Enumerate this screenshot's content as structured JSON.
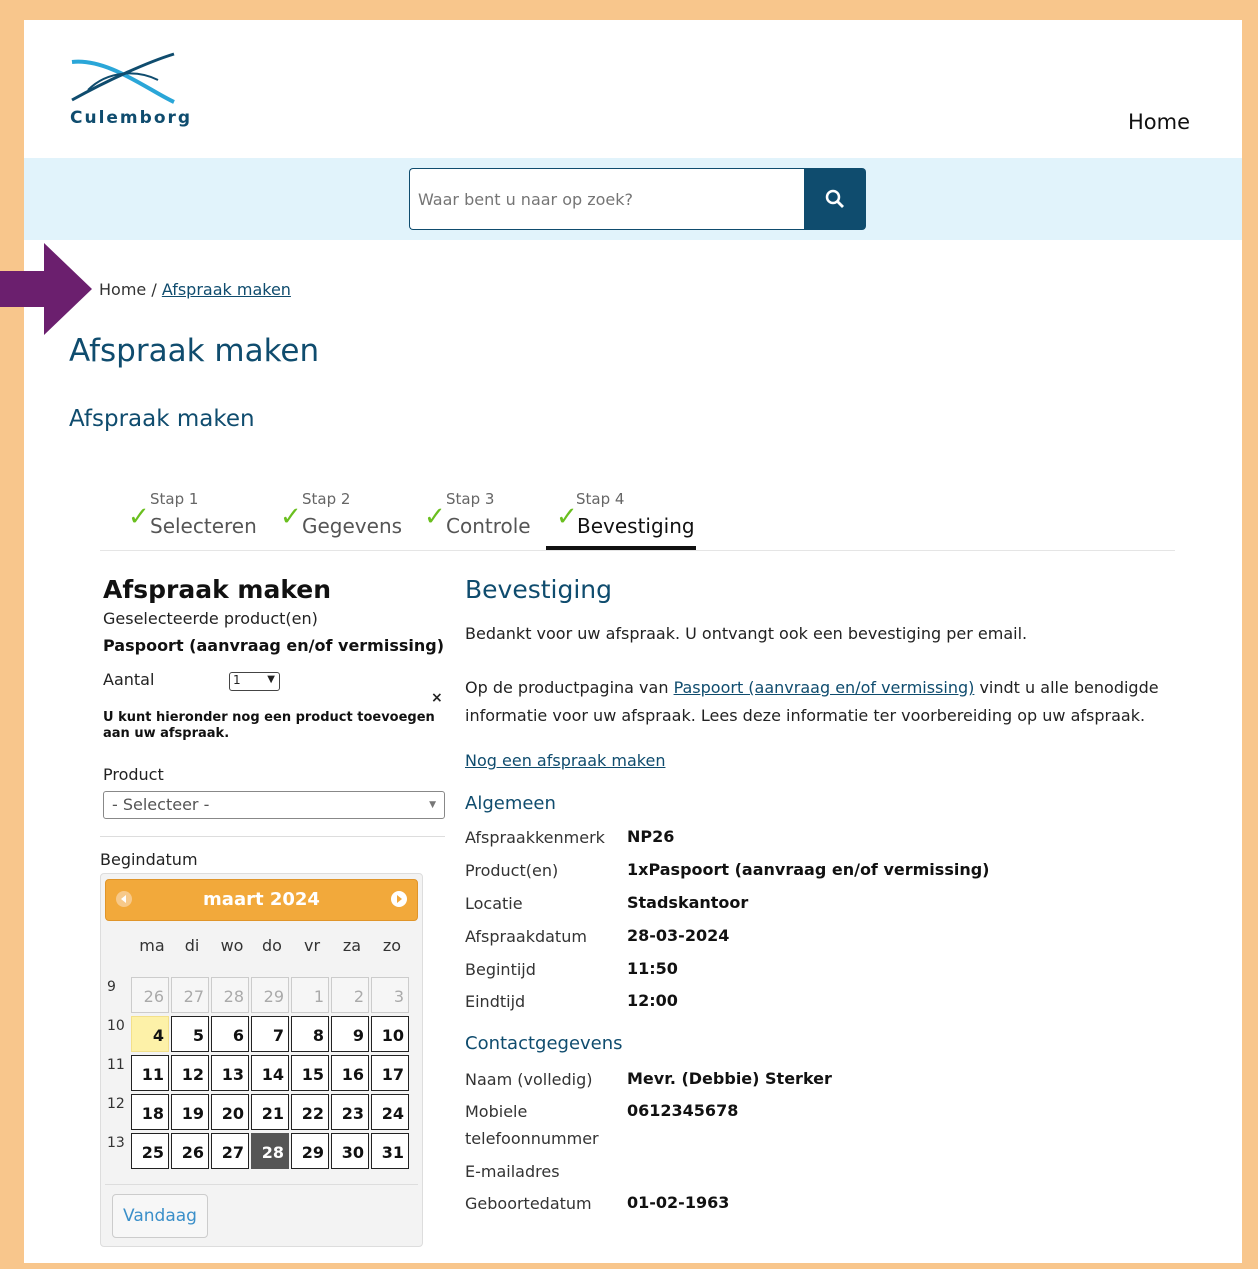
{
  "header": {
    "logo_text": "Culemborg",
    "nav_home": "Home",
    "search_placeholder": "Waar bent u naar op zoek?"
  },
  "breadcrumb": {
    "home": "Home",
    "sep": "/",
    "current": "Afspraak maken"
  },
  "page_title": "Afspraak maken",
  "section_title": "Afspraak maken",
  "steps": [
    {
      "num": "Stap 1",
      "label": "Selecteren"
    },
    {
      "num": "Stap 2",
      "label": "Gegevens"
    },
    {
      "num": "Stap 3",
      "label": "Controle"
    },
    {
      "num": "Stap 4",
      "label": "Bevestiging"
    }
  ],
  "left": {
    "title": "Afspraak maken",
    "selected_label": "Geselecteerde product(en)",
    "product_name": "Paspoort (aanvraag en/of vermissing)",
    "aantal_label": "Aantal",
    "aantal_value": "1",
    "remove_icon": "×",
    "add_note": "U kunt hieronder nog een product toevoegen aan uw afspraak.",
    "product_label": "Product",
    "product_select": "- Selecteer -",
    "begindatum_label": "Begindatum"
  },
  "calendar": {
    "month": "maart 2024",
    "dow": [
      "ma",
      "di",
      "wo",
      "do",
      "vr",
      "za",
      "zo"
    ],
    "weeks": [
      "9",
      "10",
      "11",
      "12",
      "13"
    ],
    "rows": [
      [
        "26",
        "27",
        "28",
        "29",
        "1",
        "2",
        "3"
      ],
      [
        "4",
        "5",
        "6",
        "7",
        "8",
        "9",
        "10"
      ],
      [
        "11",
        "12",
        "13",
        "14",
        "15",
        "16",
        "17"
      ],
      [
        "18",
        "19",
        "20",
        "21",
        "22",
        "23",
        "24"
      ],
      [
        "25",
        "26",
        "27",
        "28",
        "29",
        "30",
        "31"
      ]
    ],
    "today_button": "Vandaag"
  },
  "right": {
    "title": "Bevestiging",
    "thanks": "Bedankt voor uw afspraak. U ontvangt ook een bevestiging per email.",
    "info_pre": "Op de productpagina van ",
    "info_link": "Paspoort (aanvraag en/of vermissing)",
    "info_post": " vindt u alle benodigde informatie voor uw afspraak. Lees deze informatie ter voorbereiding op uw afspraak.",
    "another_link": "Nog een afspraak maken",
    "algemeen_title": "Algemeen",
    "algemeen": [
      {
        "k": "Afspraakkenmerk",
        "v": "NP26"
      },
      {
        "k": "Product(en)",
        "v": "1xPaspoort (aanvraag en/of vermissing)"
      },
      {
        "k": "Locatie",
        "v": "Stadskantoor"
      },
      {
        "k": "Afspraakdatum",
        "v": "28-03-2024"
      },
      {
        "k": "Begintijd",
        "v": "11:50"
      },
      {
        "k": "Eindtijd",
        "v": "12:00"
      }
    ],
    "contact_title": "Contactgegevens",
    "contact": [
      {
        "k": "Naam (volledig)",
        "v": "Mevr. (Debbie) Sterker"
      },
      {
        "k": "Mobiele telefoonnummer",
        "v": "0612345678"
      },
      {
        "k": "E-mailadres",
        "v": ""
      },
      {
        "k": "Geboortedatum",
        "v": "01-02-1963"
      }
    ]
  },
  "colors": {
    "brand": "#0f4c6e",
    "accent": "#f2a93b",
    "check": "#6abf1f",
    "arrow": "#6b1f6e",
    "frame": "#f8c68c"
  }
}
